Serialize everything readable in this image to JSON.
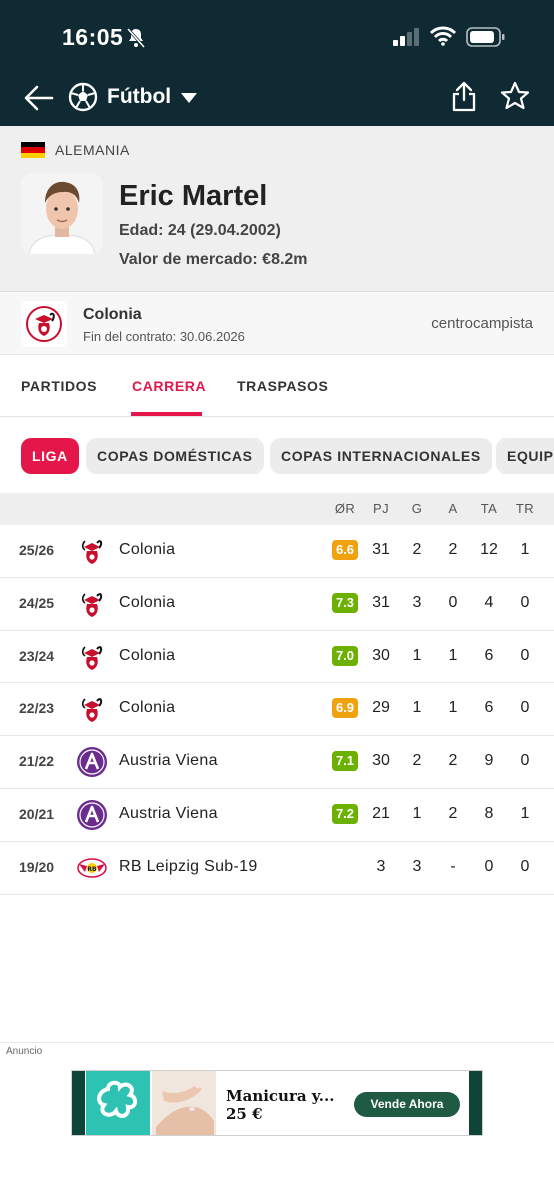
{
  "status_bar": {
    "time": "16:05"
  },
  "nav": {
    "sport": "Fútbol"
  },
  "player": {
    "country": "ALEMANIA",
    "name": "Eric Martel",
    "age": "Edad: 24 (29.04.2002)",
    "market_value": "Valor de mercado: €8.2m",
    "club": "Colonia",
    "contract": "Fin del contrato: 30.06.2026",
    "position": "centrocampista"
  },
  "tabs": [
    "PARTIDOS",
    "CARRERA",
    "TRASPASOS"
  ],
  "chips": [
    "LIGA",
    "COPAS DOMÉSTICAS",
    "COPAS INTERNACIONALES",
    "EQUIP"
  ],
  "table": {
    "headers": [
      "ØR",
      "PJ",
      "G",
      "A",
      "TA",
      "TR"
    ],
    "rows": [
      {
        "season": "25/26",
        "team": "Colonia",
        "club": "koln",
        "rating": "6.6",
        "rating_color": "#f0a20f",
        "pj": "31",
        "g": "2",
        "a": "2",
        "ta": "12",
        "tr": "1"
      },
      {
        "season": "24/25",
        "team": "Colonia",
        "club": "koln",
        "rating": "7.3",
        "rating_color": "#6db100",
        "pj": "31",
        "g": "3",
        "a": "0",
        "ta": "4",
        "tr": "0"
      },
      {
        "season": "23/24",
        "team": "Colonia",
        "club": "koln",
        "rating": "7.0",
        "rating_color": "#6db100",
        "pj": "30",
        "g": "1",
        "a": "1",
        "ta": "6",
        "tr": "0"
      },
      {
        "season": "22/23",
        "team": "Colonia",
        "club": "koln",
        "rating": "6.9",
        "rating_color": "#f0a20f",
        "pj": "29",
        "g": "1",
        "a": "1",
        "ta": "6",
        "tr": "0"
      },
      {
        "season": "21/22",
        "team": "Austria Viena",
        "club": "austria",
        "rating": "7.1",
        "rating_color": "#6db100",
        "pj": "30",
        "g": "2",
        "a": "2",
        "ta": "9",
        "tr": "0"
      },
      {
        "season": "20/21",
        "team": "Austria Viena",
        "club": "austria",
        "rating": "7.2",
        "rating_color": "#6db100",
        "pj": "21",
        "g": "1",
        "a": "2",
        "ta": "8",
        "tr": "1"
      },
      {
        "season": "19/20",
        "team": "RB Leipzig Sub-19",
        "club": "leipzig",
        "rating": "",
        "rating_color": "",
        "pj": "3",
        "g": "3",
        "a": "-",
        "ta": "0",
        "tr": "0"
      }
    ]
  },
  "ad": {
    "label": "Anuncio",
    "title": "Manicura y...",
    "price": "25 €",
    "cta": "Vende Ahora"
  },
  "colors": {
    "header_bg": "#0f2a32",
    "accent": "#e5174a"
  }
}
